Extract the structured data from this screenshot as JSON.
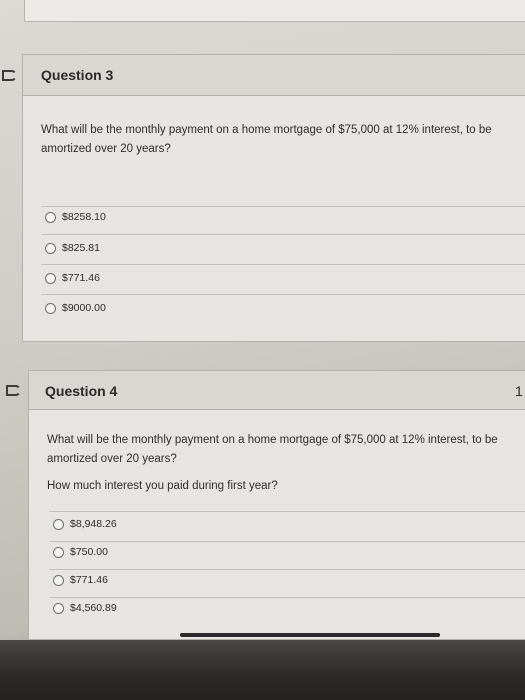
{
  "questions": [
    {
      "title": "Question 3",
      "text": "What will be the monthly payment on a home mortgage of $75,000 at 12% interest, to be amortized over 20 years?",
      "options": [
        "$8258.10",
        "$825.81",
        "$771.46",
        "$9000.00"
      ]
    },
    {
      "title": "Question 4",
      "points_fragment": "1",
      "text": "What will be the monthly payment on a home mortgage of $75,000 at 12% interest, to be amortized over 20 years?",
      "subtext": "How much interest you paid during first year?",
      "options": [
        "$8,948.26",
        "$750.00",
        "$771.46",
        "$4,560.89"
      ]
    }
  ]
}
